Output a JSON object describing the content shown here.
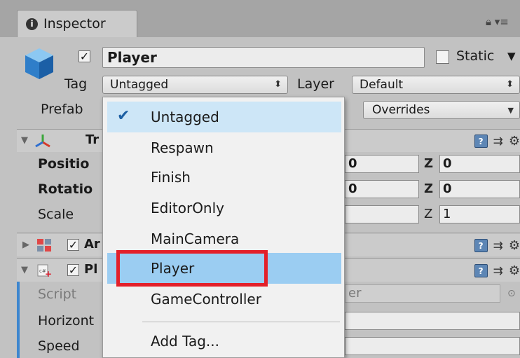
{
  "tab": {
    "title": "Inspector",
    "icon": "info-icon",
    "window_icons": [
      "lock-icon",
      "menu-icon"
    ]
  },
  "gameobject": {
    "active": true,
    "name": "Player",
    "static_label": "Static",
    "static": false,
    "tag_label": "Tag",
    "tag_value": "Untagged",
    "layer_label": "Layer",
    "layer_value": "Default",
    "prefab_label": "Prefab",
    "overrides_label": "Overrides"
  },
  "components": {
    "transform": {
      "name_partial": "Tr",
      "rows": [
        {
          "label": "Positio",
          "z_label": "Z",
          "z_value": "0",
          "x_fragment": "0"
        },
        {
          "label": "Rotatio",
          "z_label": "Z",
          "z_value": "0",
          "x_fragment": "0"
        },
        {
          "label": "Scale",
          "z_label": "Z",
          "z_value": "1",
          "x_fragment": ""
        }
      ]
    },
    "animator": {
      "name_partial": "Ar",
      "enabled": true
    },
    "player_script": {
      "name_partial": "Pl",
      "enabled": true,
      "rows": [
        {
          "label": "Script",
          "value_fragment": "er"
        },
        {
          "label": "Horizont"
        },
        {
          "label": "Speed"
        }
      ]
    }
  },
  "tag_menu": {
    "items": [
      {
        "label": "Untagged",
        "checked": true
      },
      {
        "label": "Respawn"
      },
      {
        "label": "Finish"
      },
      {
        "label": "EditorOnly"
      },
      {
        "label": "MainCamera"
      },
      {
        "label": "Player",
        "highlighted": true
      },
      {
        "label": "GameController"
      }
    ],
    "add_tag": "Add Tag..."
  },
  "colors": {
    "highlight": "#9bcdf2",
    "annotation": "#e3202a",
    "accent_blue": "#3d86cf"
  }
}
